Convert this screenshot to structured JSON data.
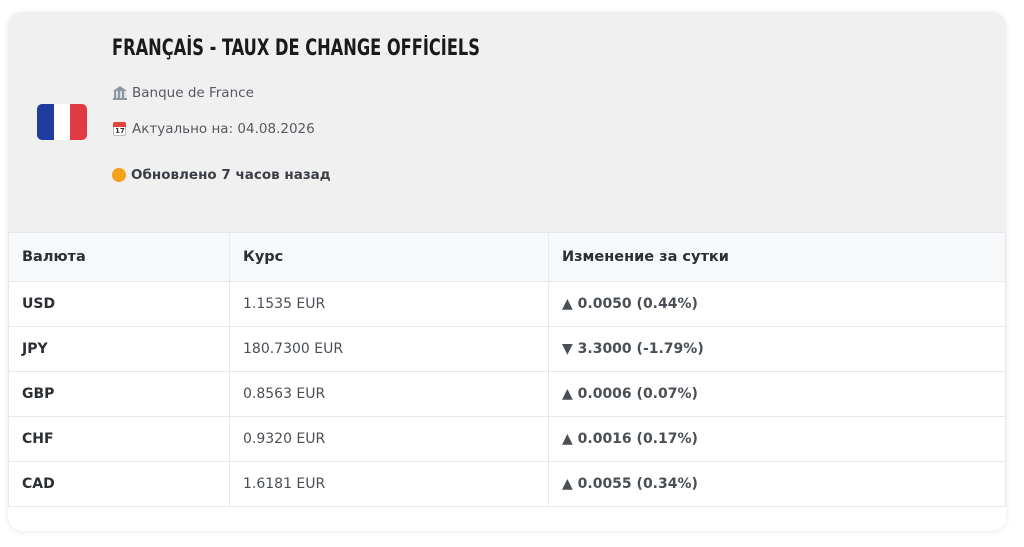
{
  "header": {
    "title": "FRANÇAİS - TAUX DE CHANGE OFFİCİELS",
    "source_icon": "bank-icon",
    "source": "Banque de France",
    "date_icon": "calendar-icon",
    "date_label": "Актуально на: 04.08.2026",
    "status_color": "#f5a11c",
    "status": "Обновлено 7 часов назад",
    "flag": {
      "name": "france-flag-icon",
      "colors": [
        "#1f3c9e",
        "#ffffff",
        "#e03a45"
      ]
    }
  },
  "table": {
    "columns": [
      "Валюта",
      "Курс",
      "Изменение за сутки"
    ],
    "rows": [
      {
        "code": "USD",
        "rate": "1.1535 EUR",
        "change": "▲ 0.0050 (0.44%)",
        "direction": "up"
      },
      {
        "code": "JPY",
        "rate": "180.7300 EUR",
        "change": "▼ 3.3000 (-1.79%)",
        "direction": "down"
      },
      {
        "code": "GBP",
        "rate": "0.8563 EUR",
        "change": "▲ 0.0006 (0.07%)",
        "direction": "up"
      },
      {
        "code": "CHF",
        "rate": "0.9320 EUR",
        "change": "▲ 0.0016 (0.17%)",
        "direction": "up"
      },
      {
        "code": "CAD",
        "rate": "1.6181 EUR",
        "change": "▲ 0.0055 (0.34%)",
        "direction": "up"
      }
    ]
  },
  "colors": {
    "up": "#28a745",
    "down": "#dc3b3b"
  }
}
